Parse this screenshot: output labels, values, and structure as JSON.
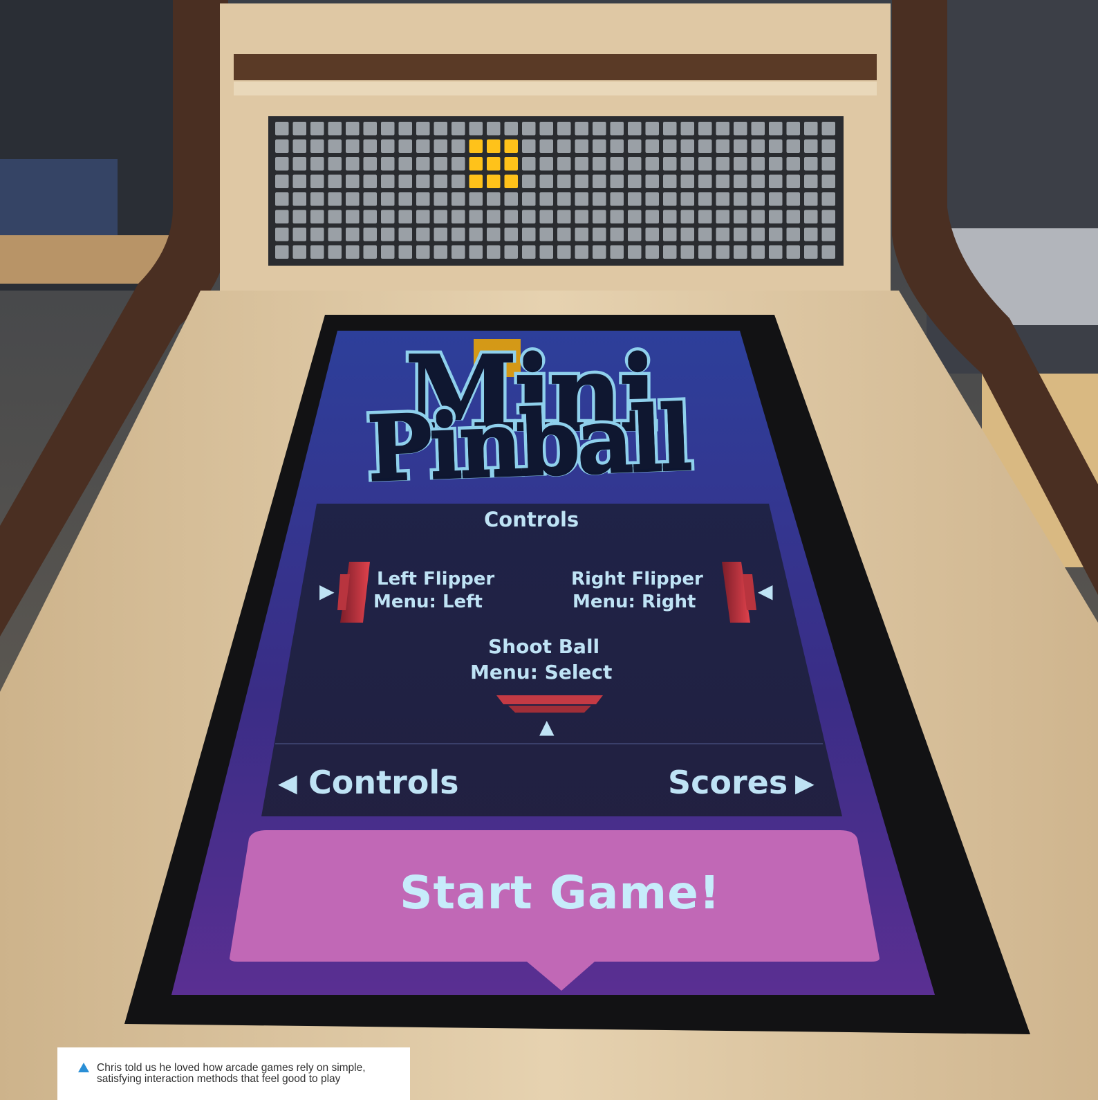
{
  "screen": {
    "title_line1": "Mini",
    "title_line2": "Pinball",
    "controls_heading": "Controls",
    "left_flipper": {
      "line1": "Left Flipper",
      "line2": "Menu: Left"
    },
    "right_flipper": {
      "line1": "Right Flipper",
      "line2": "Menu: Right"
    },
    "shoot_ball": {
      "line1": "Shoot Ball",
      "line2": "Menu: Select"
    },
    "nav_prev_label": "Controls",
    "nav_next_label": "Scores",
    "start_button_label": "Start Game!"
  },
  "dot_matrix": {
    "columns": 32,
    "rows": 8,
    "lit_color": "#ffc21a",
    "unlit_color": "#9aa0a6"
  },
  "caption": {
    "text": "Chris told us he loved how arcade games rely on simple, satisfying interaction methods that feel good to play"
  },
  "colors": {
    "wood": "#d9c3a0",
    "wood_edge": "#4a2f22",
    "screen_top": "#2c3f95",
    "screen_bottom": "#4a2b86",
    "button_pink": "#c066b4",
    "text_cyan": "#bfe3f5",
    "caption_icon": "#2a8fd6"
  }
}
